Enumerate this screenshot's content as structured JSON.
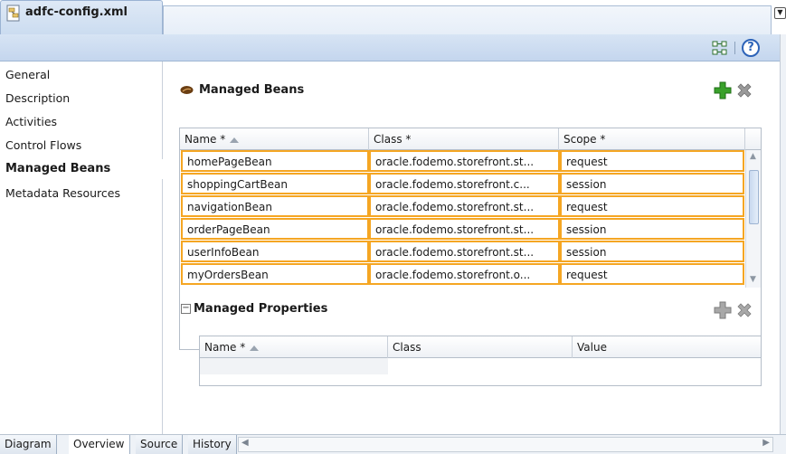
{
  "editor_tab": {
    "filename": "adfc-config.xml"
  },
  "toolbar": {
    "help_label": "?"
  },
  "leftnav": {
    "items": [
      {
        "label": "General"
      },
      {
        "label": "Description"
      },
      {
        "label": "Activities"
      },
      {
        "label": "Control Flows"
      },
      {
        "label": "Managed Beans",
        "selected": true
      },
      {
        "label": "Metadata Resources"
      }
    ]
  },
  "managed_beans": {
    "title": "Managed Beans",
    "columns": [
      "Name *",
      "Class *",
      "Scope *"
    ],
    "rows": [
      {
        "name": "homePageBean",
        "class": "oracle.fodemo.storefront.st...",
        "scope": "request"
      },
      {
        "name": "shoppingCartBean",
        "class": "oracle.fodemo.storefront.c...",
        "scope": "session"
      },
      {
        "name": "navigationBean",
        "class": "oracle.fodemo.storefront.st...",
        "scope": "request"
      },
      {
        "name": "orderPageBean",
        "class": "oracle.fodemo.storefront.st...",
        "scope": "session"
      },
      {
        "name": "userInfoBean",
        "class": "oracle.fodemo.storefront.st...",
        "scope": "session"
      },
      {
        "name": "myOrdersBean",
        "class": "oracle.fodemo.storefront.o...",
        "scope": "request"
      }
    ]
  },
  "managed_properties": {
    "toggle": "−",
    "title": "Managed Properties",
    "columns": [
      "Name *",
      "Class",
      "Value"
    ]
  },
  "bottom_tabs": [
    {
      "label": "Diagram"
    },
    {
      "label": "Overview",
      "selected": true
    },
    {
      "label": "Source"
    },
    {
      "label": "History"
    }
  ],
  "colors": {
    "selection_border": "#f5a623",
    "add_icon": "#3aa12b",
    "delete_icon": "#8c8c8c",
    "toolbar": "#c4d6ee"
  }
}
